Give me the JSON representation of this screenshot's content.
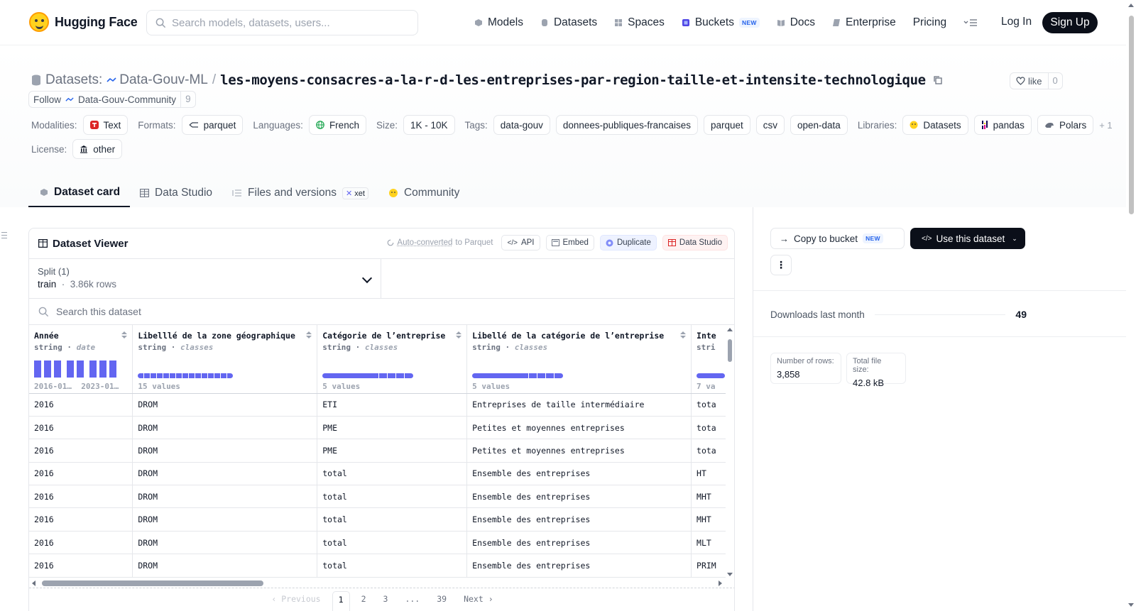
{
  "header": {
    "brand": "Hugging Face",
    "search_placeholder": "Search models, datasets, users...",
    "nav": [
      {
        "label": "Models",
        "icon": "cube-icon"
      },
      {
        "label": "Datasets",
        "icon": "database-icon"
      },
      {
        "label": "Spaces",
        "icon": "grid-icon"
      },
      {
        "label": "Buckets",
        "icon": "bucket-icon",
        "badge": "NEW"
      },
      {
        "label": "Docs",
        "icon": "book-icon"
      },
      {
        "label": "Enterprise",
        "icon": "briefcase-icon"
      },
      {
        "label": "Pricing"
      }
    ],
    "login": "Log In",
    "signup": "Sign Up"
  },
  "dataset": {
    "prefix": "Datasets:",
    "org": "Data-Gouv-ML",
    "sep": "/",
    "name": "les-moyens-consacres-a-la-r-d-les-entreprises-par-region-taille-et-intensite-technologique",
    "like_label": "like",
    "like_count": "0",
    "follow_label": "Follow",
    "follow_org": "Data-Gouv-Community",
    "follow_count": "9",
    "modalities_label": "Modalities:",
    "modalities": [
      "Text"
    ],
    "formats_label": "Formats:",
    "formats": [
      "parquet"
    ],
    "languages_label": "Languages:",
    "languages": [
      "French"
    ],
    "size_label": "Size:",
    "size": "1K - 10K",
    "tags_label": "Tags:",
    "tags": [
      "data-gouv",
      "donnees-publiques-francaises",
      "parquet",
      "csv",
      "open-data"
    ],
    "libraries_label": "Libraries:",
    "libraries": [
      "Datasets",
      "pandas",
      "Polars"
    ],
    "libraries_more": "+ 1",
    "license_label": "License:",
    "license": "other"
  },
  "tabs": [
    {
      "label": "Dataset card",
      "active": true
    },
    {
      "label": "Data Studio"
    },
    {
      "label": "Files and versions",
      "badge": "xet"
    },
    {
      "label": "Community"
    }
  ],
  "viewer": {
    "title": "Dataset Viewer",
    "auto_converted": "Auto-converted",
    "to_parquet": "to Parquet",
    "actions": [
      "API",
      "Embed",
      "Duplicate",
      "Data Studio"
    ],
    "split_label": "Split (1)",
    "split_value": "train",
    "split_rows": "3.86k rows",
    "search_placeholder": "Search this dataset",
    "columns": [
      {
        "name": "Année",
        "type": "string",
        "kind": "date",
        "footer_left": "2016-01…",
        "footer_right": "2023-01…"
      },
      {
        "name": "Libelllé de la zone géographique",
        "type": "string",
        "kind": "classes",
        "footer": "15 values"
      },
      {
        "name": "Catégorie de l’entreprise",
        "type": "string",
        "kind": "classes",
        "footer": "5 values"
      },
      {
        "name": "Libellé de la catégorie de l’entreprise",
        "type": "string",
        "kind": "classes",
        "footer": "5 values"
      },
      {
        "name": "Inte",
        "type": "stri",
        "kind": "",
        "footer": "7 va"
      }
    ],
    "rows": [
      [
        "2016",
        "DROM",
        "ETI",
        "Entreprises de taille intermédiaire",
        "tota"
      ],
      [
        "2016",
        "DROM",
        "PME",
        "Petites et moyennes entreprises",
        "tota"
      ],
      [
        "2016",
        "DROM",
        "PME",
        "Petites et moyennes entreprises",
        "tota"
      ],
      [
        "2016",
        "DROM",
        "total",
        "Ensemble des entreprises",
        "HT"
      ],
      [
        "2016",
        "DROM",
        "total",
        "Ensemble des entreprises",
        "MHT"
      ],
      [
        "2016",
        "DROM",
        "total",
        "Ensemble des entreprises",
        "MHT"
      ],
      [
        "2016",
        "DROM",
        "total",
        "Ensemble des entreprises",
        "MLT"
      ],
      [
        "2016",
        "DROM",
        "total",
        "Ensemble des entreprises",
        "PRIM"
      ]
    ],
    "pager": {
      "prev": "‹ Previous",
      "pages": [
        "1",
        "2",
        "3",
        "...",
        "39"
      ],
      "next": "Next ›",
      "current": "1"
    }
  },
  "sidebar": {
    "copy_label": "Copy to bucket",
    "copy_badge": "NEW",
    "use_label": "Use this dataset",
    "more_label": "⋮",
    "downloads_label": "Downloads last month",
    "downloads_value": "49",
    "rows_label": "Number of rows:",
    "rows_value": "3,858",
    "size_label": "Total file size:",
    "size_value": "42.8 kB"
  },
  "colors": {
    "accent": "#6366f1",
    "dark": "#0b0f19",
    "new_badge": "#2563eb"
  }
}
